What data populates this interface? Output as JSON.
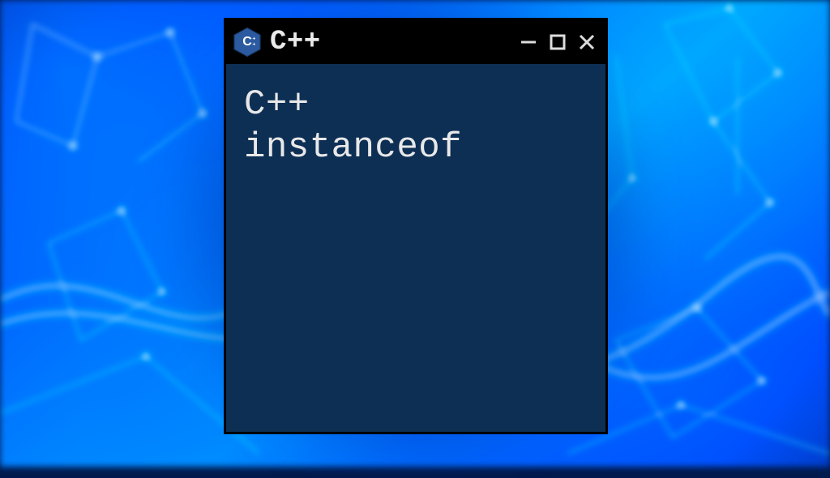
{
  "window": {
    "title": "C++",
    "icon": "cpp-hex-icon",
    "controls": {
      "minimize": "–",
      "maximize": "☐",
      "close": "✕"
    }
  },
  "content": {
    "line1": "C++",
    "line2": "instanceof"
  },
  "colors": {
    "window_bg": "#0d2f54",
    "titlebar_bg": "#000000",
    "text": "#e8e8e8"
  }
}
